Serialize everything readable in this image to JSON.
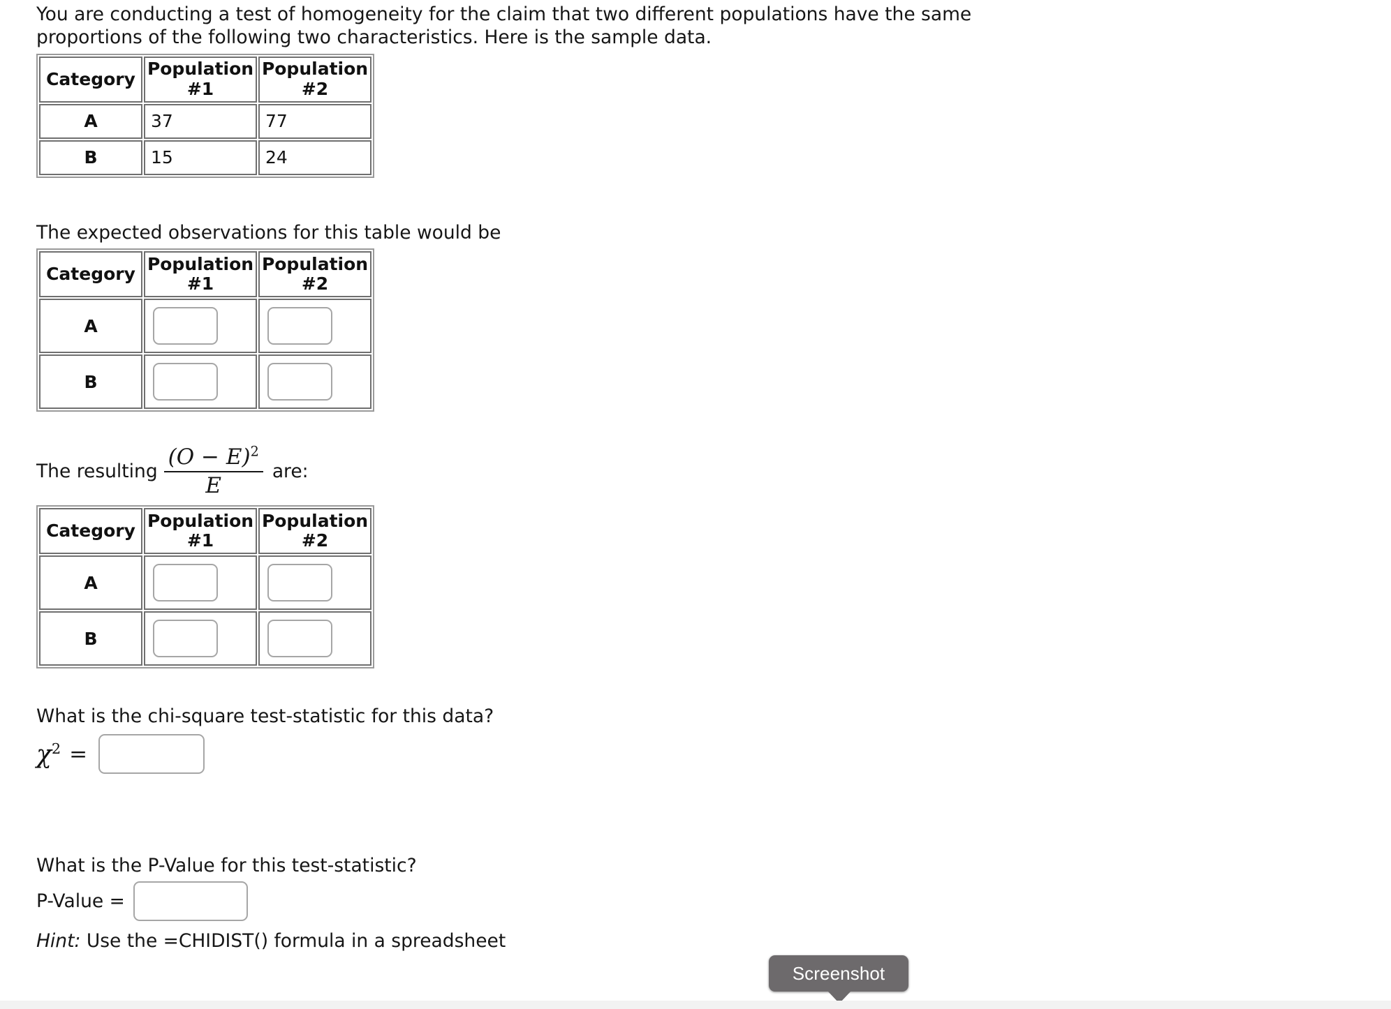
{
  "intro": {
    "paragraph": "You are conducting a test of homogeneity for the claim that two different populations have the same proportions of the following two characteristics. Here is the sample data."
  },
  "sample_table": {
    "headers": [
      "Category",
      "Population #1",
      "Population #2"
    ],
    "header_lines": [
      [
        "Category"
      ],
      [
        "Population",
        "#1"
      ],
      [
        "Population",
        "#2"
      ]
    ],
    "rows": [
      {
        "category": "A",
        "pop1": "37",
        "pop2": "77"
      },
      {
        "category": "B",
        "pop1": "15",
        "pop2": "24"
      }
    ]
  },
  "expected_section": {
    "label": "The expected observations for this table would be",
    "headers": [
      "Category",
      "Population #1",
      "Population #2"
    ],
    "header_lines": [
      [
        "Category"
      ],
      [
        "Population",
        "#1"
      ],
      [
        "Population",
        "#2"
      ]
    ],
    "rows": [
      {
        "category": "A",
        "pop1_value": "",
        "pop2_value": ""
      },
      {
        "category": "B",
        "pop1_value": "",
        "pop2_value": ""
      }
    ]
  },
  "resulting_section": {
    "lead_text": "The resulting",
    "formula_numerator": "(O − E)",
    "formula_numerator_exponent": "2",
    "formula_denominator": "E",
    "trail_text": "are:",
    "headers": [
      "Category",
      "Population #1",
      "Population #2"
    ],
    "header_lines": [
      [
        "Category"
      ],
      [
        "Population",
        "#1"
      ],
      [
        "Population",
        "#2"
      ]
    ],
    "rows": [
      {
        "category": "A",
        "pop1_value": "",
        "pop2_value": ""
      },
      {
        "category": "B",
        "pop1_value": "",
        "pop2_value": ""
      }
    ]
  },
  "chi_square": {
    "question": "What is the chi-square test-statistic for this data?",
    "symbol": "χ",
    "symbol_exponent": "2",
    "equals": "=",
    "value": ""
  },
  "p_value": {
    "question": "What is the P-Value for this test-statistic?",
    "label": "P-Value =",
    "value": "",
    "hint_prefix": "Hint:",
    "hint_text": " Use the =CHIDIST() formula in a spreadsheet"
  },
  "overlay": {
    "screenshot_badge": "Screenshot"
  },
  "colors": {
    "table_outer_border": "#9a9a9a",
    "table_cell_border": "#6f6f6f",
    "input_border": "#a6a6a6",
    "badge_background": "#6d6a6c",
    "text": "#161616"
  }
}
